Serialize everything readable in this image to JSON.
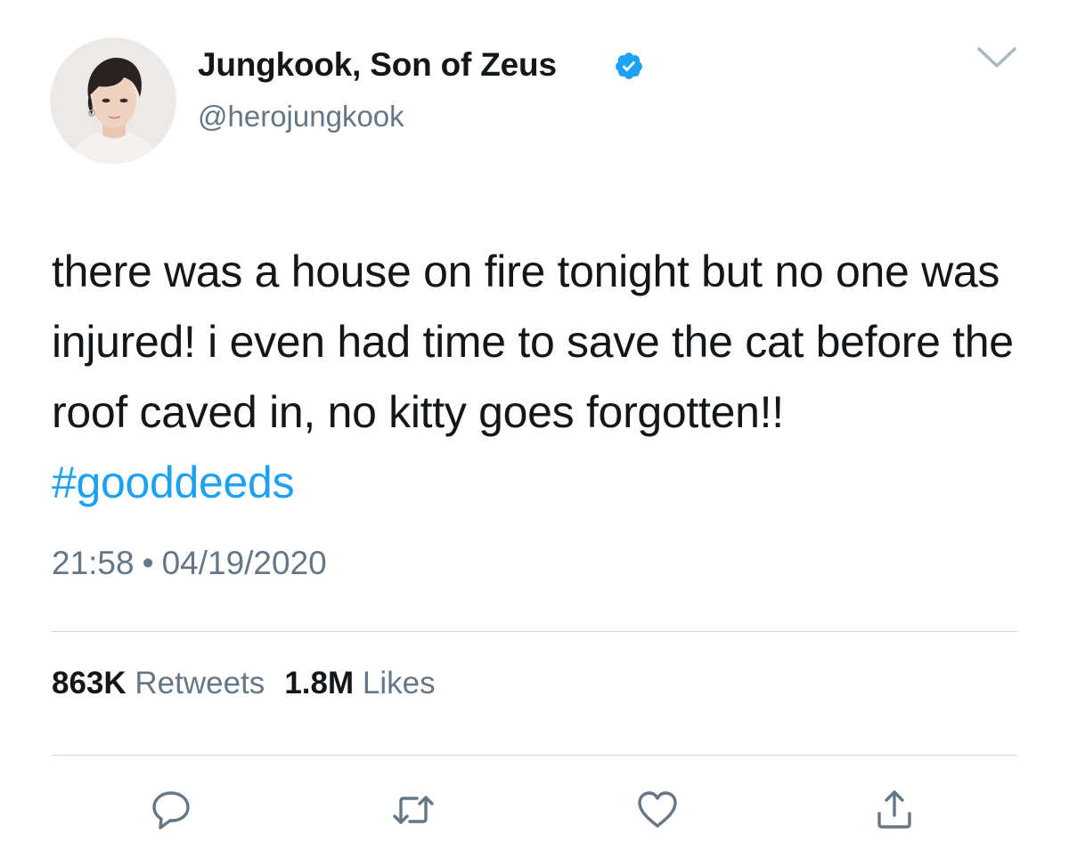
{
  "user": {
    "display_name": "Jungkook, Son of Zeus",
    "handle": "@herojungkook",
    "verified": true,
    "avatar_icon": "profile-photo"
  },
  "tweet": {
    "text_plain": "there was a house on fire tonight but no one was injured! i even had time to save the cat before the roof caved in, no kitty goes forgotten!!",
    "hashtag": "#gooddeeds",
    "time": "21:58",
    "separator": "•",
    "date": "04/19/2020"
  },
  "stats": {
    "retweets_count": "863K",
    "retweets_label": "Retweets",
    "likes_count": "1.8M",
    "likes_label": "Likes"
  },
  "actions": [
    {
      "name": "reply",
      "icon": "reply-icon"
    },
    {
      "name": "retweet",
      "icon": "retweet-icon"
    },
    {
      "name": "like",
      "icon": "heart-icon"
    },
    {
      "name": "share",
      "icon": "share-icon"
    }
  ],
  "colors": {
    "text": "#14171a",
    "secondary": "#657786",
    "accent": "#1da1f2",
    "divider": "#cfd6dc"
  }
}
